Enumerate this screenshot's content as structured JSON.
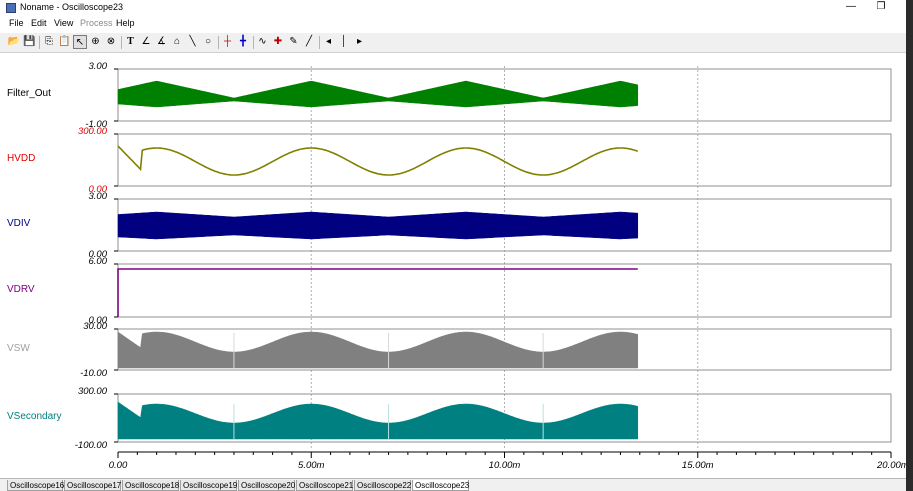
{
  "window": {
    "title": "Noname - Oscilloscope23",
    "restore_icon": "restore-icon",
    "minimize_icon": "minimize-icon"
  },
  "menu": [
    {
      "label": "File",
      "enabled": true
    },
    {
      "label": "Edit",
      "enabled": true
    },
    {
      "label": "View",
      "enabled": true
    },
    {
      "label": "Process",
      "enabled": false
    },
    {
      "label": "Help",
      "enabled": true
    }
  ],
  "toolbar": [
    "open-icon",
    "save-icon",
    "sep",
    "copy-icon",
    "paste-icon",
    "pointer-icon",
    "zoom-in-icon",
    "zoom-area-icon",
    "sep",
    "text-icon",
    "probe-icon",
    "probe2-icon",
    "marker-icon",
    "line-icon",
    "circle-icon",
    "sep",
    "cursor-icon",
    "cursor2-icon",
    "sep",
    "waveform-icon",
    "add-trace-icon",
    "pen-icon",
    "ramp-icon",
    "sep",
    "left-icon",
    "step-icon",
    "right-icon"
  ],
  "x_axis": {
    "ticks": [
      "0.00",
      "5.00m",
      "10.00m",
      "15.00m",
      "20.00m"
    ],
    "range": [
      0,
      0.02
    ],
    "grid": true
  },
  "traces": [
    {
      "label": "Filter_Out",
      "label_color": "#000000",
      "color": "#008000",
      "ymax": "3.00",
      "ymin": "-1.00",
      "scale_color": "#000000"
    },
    {
      "label": "HVDD",
      "label_color": "#e00000",
      "color": "#808000",
      "ymax": "300.00",
      "ymin": "0.00",
      "scale_color": "#e00000"
    },
    {
      "label": "VDIV",
      "label_color": "#000080",
      "color": "#000080",
      "ymax": "3.00",
      "ymin": "0.00",
      "scale_color": "#000000"
    },
    {
      "label": "VDRV",
      "label_color": "#800080",
      "color": "#800080",
      "ymax": "6.00",
      "ymin": "0.00",
      "scale_color": "#000000"
    },
    {
      "label": "VSW",
      "label_color": "#a0a0a0",
      "color": "#808080",
      "ymax": "30.00",
      "ymin": "-10.00",
      "scale_color": "#000000"
    },
    {
      "label": "VSecondary",
      "label_color": "#008080",
      "color": "#008080",
      "ymax": "300.00",
      "ymin": "-100.00",
      "scale_color": "#000000"
    }
  ],
  "tabs": [
    "Oscilloscope16",
    "Oscilloscope17",
    "Oscilloscope18",
    "Oscilloscope19",
    "Oscilloscope20",
    "Oscilloscope21",
    "Oscilloscope22",
    "Oscilloscope23"
  ],
  "active_tab": "Oscilloscope23"
}
